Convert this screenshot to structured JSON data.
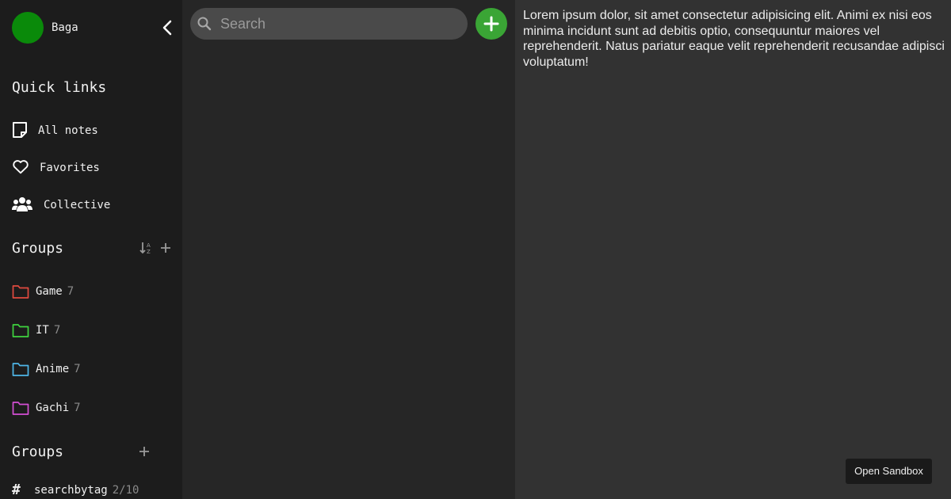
{
  "profile": {
    "name": "Baga"
  },
  "quick_links": {
    "title": "Quick links",
    "items": [
      {
        "label": "All notes",
        "icon": "note-icon"
      },
      {
        "label": "Favorites",
        "icon": "heart-icon"
      },
      {
        "label": "Collective",
        "icon": "users-icon"
      }
    ]
  },
  "groups": {
    "title": "Groups",
    "items": [
      {
        "label": "Game",
        "count": "7",
        "color": "#e04a3f"
      },
      {
        "label": "IT",
        "count": "7",
        "color": "#3fd43f"
      },
      {
        "label": "Anime",
        "count": "7",
        "color": "#4fb6e8"
      },
      {
        "label": "Gachi",
        "count": "7",
        "color": "#d44fd4"
      }
    ]
  },
  "tags": {
    "title": "Groups",
    "items": [
      {
        "label": "searchbytag",
        "count": "2/10"
      }
    ]
  },
  "search": {
    "placeholder": "Search"
  },
  "note": {
    "text": "Lorem ipsum dolor, sit amet consectetur adipisicing elit. Animi ex nisi eos minima incidunt sunt ad debitis optio, consequuntur maiores vel reprehenderit. Natus pariatur eaque velit reprehenderit recusandae adipisci voluptatum!"
  },
  "sandbox": {
    "label": "Open Sandbox"
  },
  "colors": {
    "accent": "#3aa535",
    "avatar": "#0a8a0a",
    "sidebar_bg": "#1c1c1c",
    "list_bg": "#262626",
    "editor_bg": "#323232"
  }
}
